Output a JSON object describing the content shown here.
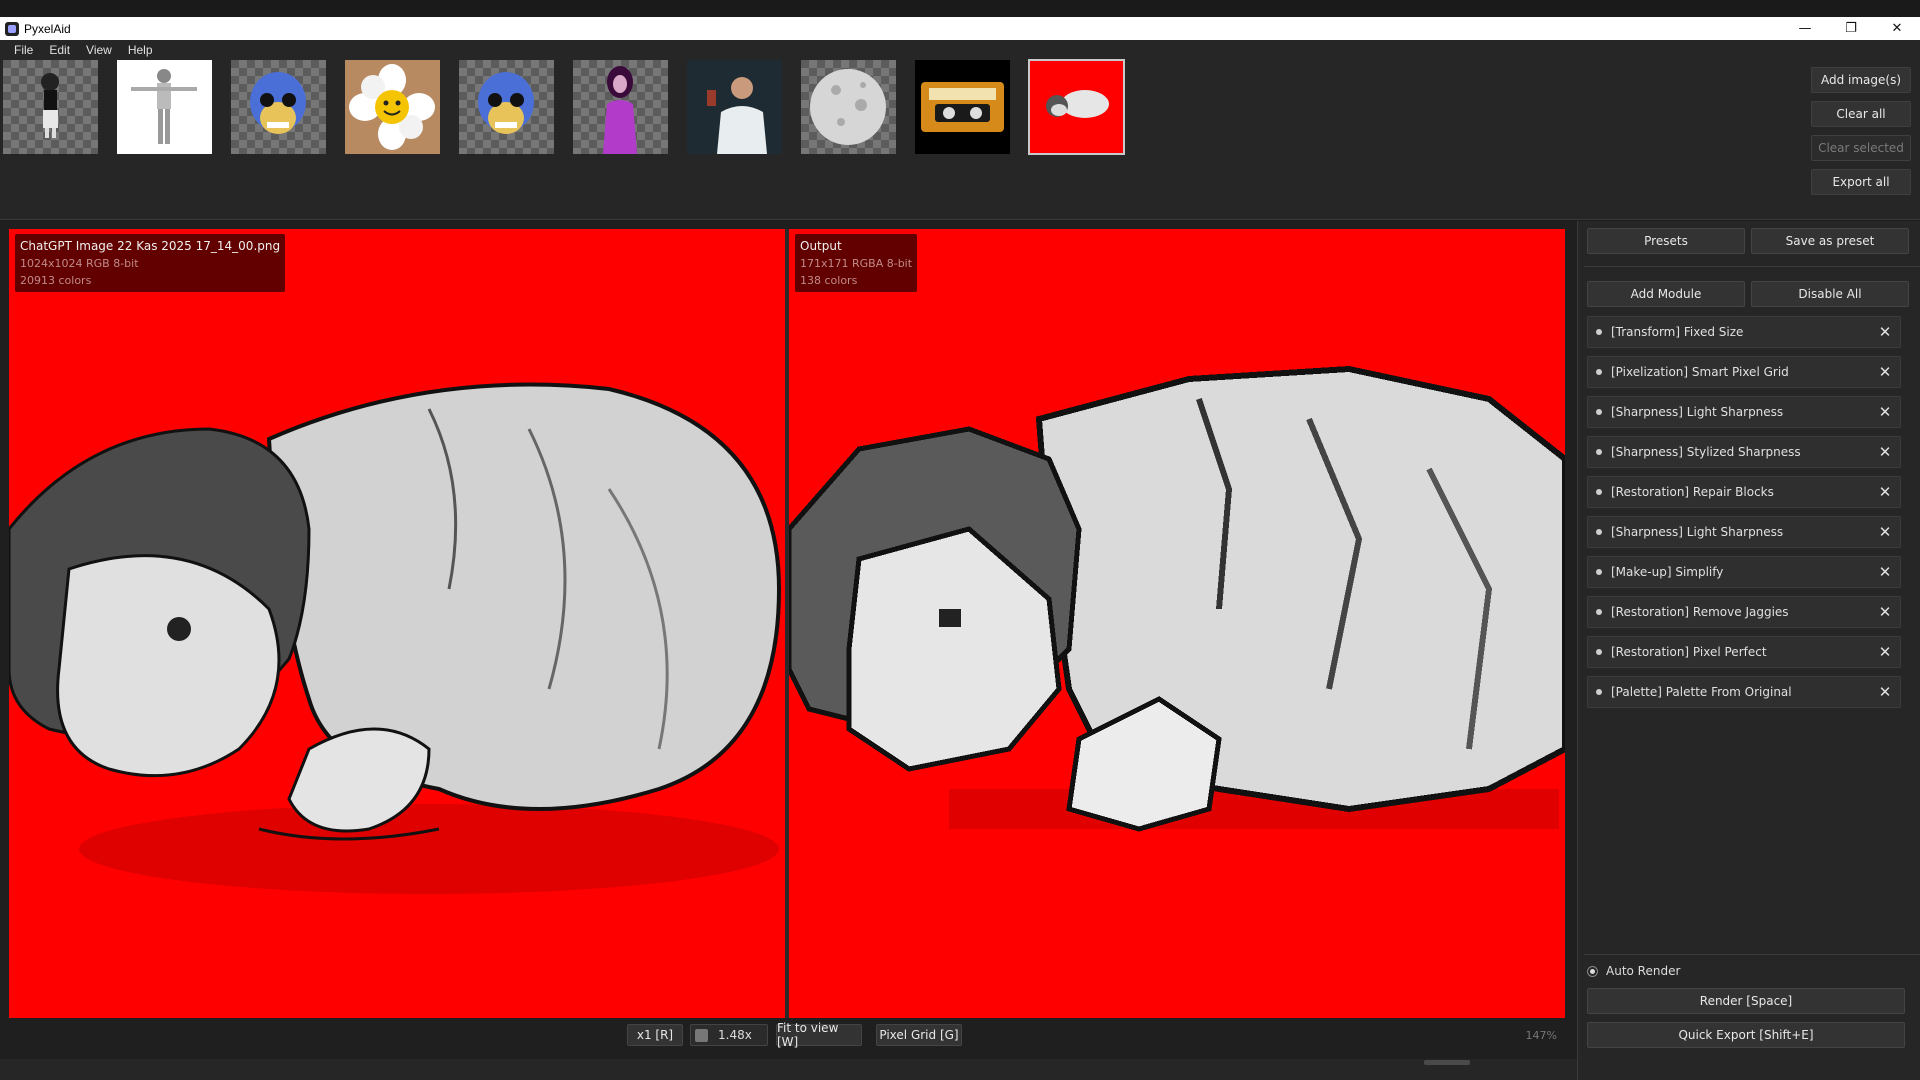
{
  "window": {
    "title": "PyxelAid",
    "minimize_glyph": "—",
    "restore_glyph": "❐",
    "close_glyph": "✕"
  },
  "menu": [
    "File",
    "Edit",
    "View",
    "Help"
  ],
  "gallery": {
    "thumbnails": [
      {
        "name": "girl-sprite-thumbnail",
        "bg": "checker"
      },
      {
        "name": "t-pose-character-thumbnail",
        "bg": "#ffffff"
      },
      {
        "name": "blue-skull-thumbnail",
        "bg": "checker"
      },
      {
        "name": "smiling-flower-thumbnail",
        "bg": "#b78a62"
      },
      {
        "name": "blue-skull-2-thumbnail",
        "bg": "checker"
      },
      {
        "name": "purple-woman-thumbnail",
        "bg": "checker"
      },
      {
        "name": "scientist-photo-thumbnail",
        "bg": "#1f2b33"
      },
      {
        "name": "moon-sphere-thumbnail",
        "bg": "checker"
      },
      {
        "name": "cassette-tape-thumbnail",
        "bg": "#000000"
      },
      {
        "name": "sleeping-child-thumbnail",
        "bg": "#ff0000",
        "selected": true
      }
    ],
    "buttons": {
      "add": "Add image(s)",
      "clear_all": "Clear all",
      "clear_selected": "Clear selected",
      "export_all": "Export all"
    }
  },
  "input_info": {
    "filename": "ChatGPT Image 22 Kas 2025 17_14_00.png",
    "dims": "1024x1024  RGB   8-bit",
    "colors": "20913 colors"
  },
  "output_info": {
    "title": "Output",
    "dims": "171x171  RGBA  8-bit",
    "colors": "138 colors"
  },
  "toolbar": {
    "scale": "x1 [R]",
    "zoom_value": "1.48x",
    "fit": "Fit to view [W]",
    "grid": "Pixel Grid [G]",
    "zoom_percent": "147%"
  },
  "panel": {
    "presets": "Presets",
    "save_preset": "Save as preset",
    "add_module": "Add Module",
    "disable_all": "Disable All",
    "modules": [
      "[Transform] Fixed Size",
      "[Pixelization] Smart Pixel Grid",
      "[Sharpness] Light Sharpness",
      "[Sharpness] Stylized Sharpness",
      "[Restoration] Repair Blocks",
      "[Sharpness] Light Sharpness",
      "[Make-up] Simplify",
      "[Restoration] Remove Jaggies",
      "[Restoration] Pixel Perfect",
      "[Palette] Palette From Original"
    ],
    "module_close_glyph": "✕",
    "auto_render": "Auto Render",
    "render": "Render  [Space]",
    "quick_export": "Quick Export  [Shift+E]"
  }
}
